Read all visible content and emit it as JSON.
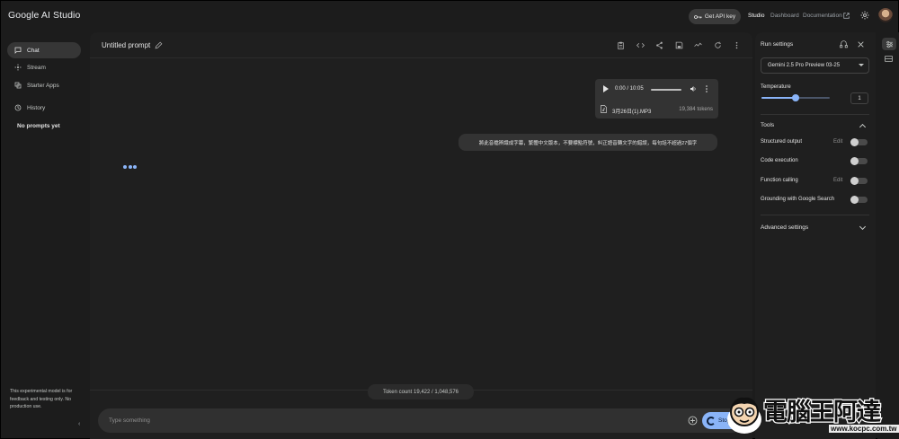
{
  "app": {
    "title": "Google AI Studio",
    "get_api_key": "Get API key",
    "nav": [
      "Studio",
      "Dashboard",
      "Documentation"
    ]
  },
  "sidebar": {
    "items": [
      {
        "label": "Chat",
        "icon": "chat-icon",
        "active": true
      },
      {
        "label": "Stream",
        "icon": "stream-icon",
        "active": false
      },
      {
        "label": "Starter Apps",
        "icon": "starter-apps-icon",
        "active": false
      },
      {
        "label": "History",
        "icon": "history-icon",
        "active": false
      }
    ],
    "empty_history": "No prompts yet",
    "disclaimer": "This experimental model is for feedback and testing only. No production use."
  },
  "main": {
    "prompt_title": "Untitled prompt",
    "audio": {
      "time": "0:00 / 10:05",
      "file_name": "3月26日(1).MP3",
      "tokens": "19,384 tokens"
    },
    "user_message": "將此音檔辨識成字幕，繁體中文版本，不要標點符號，糾正語音轉文字的錯誤，每句話不超過27個字",
    "token_count": "Token count 19,422 / 1,048,576",
    "input_placeholder": "Type something",
    "stop_label": "Stop"
  },
  "run_settings": {
    "title": "Run settings",
    "model": "Gemini 2.5 Pro Preview 03-25",
    "temperature_label": "Temperature",
    "temperature_value": "1",
    "temperature_fraction": 0.5,
    "tools_label": "Tools",
    "tools": [
      {
        "label": "Structured output",
        "edit": "Edit"
      },
      {
        "label": "Code execution",
        "edit": ""
      },
      {
        "label": "Function calling",
        "edit": "Edit"
      },
      {
        "label": "Grounding with Google Search",
        "edit": ""
      }
    ],
    "advanced_label": "Advanced settings"
  },
  "watermark": {
    "brand": "電腦王阿達",
    "url": "www.kocpc.com.tw"
  },
  "colors": {
    "accent": "#8ab4f8",
    "background": "#1c1c1c",
    "panel": "#1f1f1f"
  }
}
